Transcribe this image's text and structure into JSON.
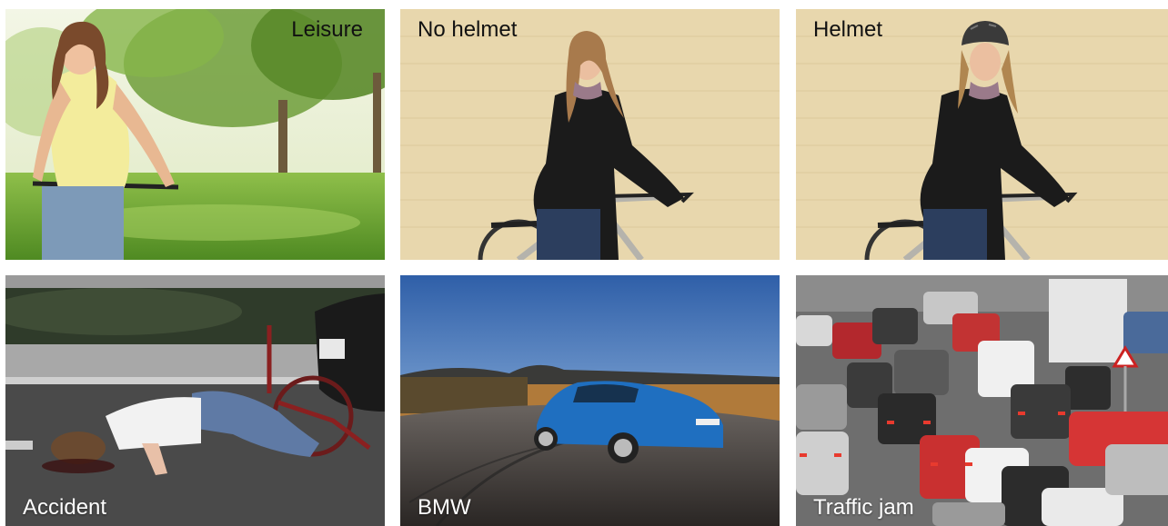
{
  "panels": [
    {
      "key": "leisure",
      "label": "Leisure"
    },
    {
      "key": "no_helmet",
      "label": "No helmet"
    },
    {
      "key": "helmet",
      "label": "Helmet"
    },
    {
      "key": "accident",
      "label": "Accident"
    },
    {
      "key": "bmw",
      "label": "BMW"
    },
    {
      "key": "traffic_jam",
      "label": "Traffic jam"
    }
  ],
  "colors": {
    "label_dark": "#111111",
    "label_light": "#ffffff",
    "wall": "#e8d7ad",
    "grass": "#5f9a2e",
    "sky": "#3f73b8",
    "car_blue": "#1f6fc0"
  }
}
